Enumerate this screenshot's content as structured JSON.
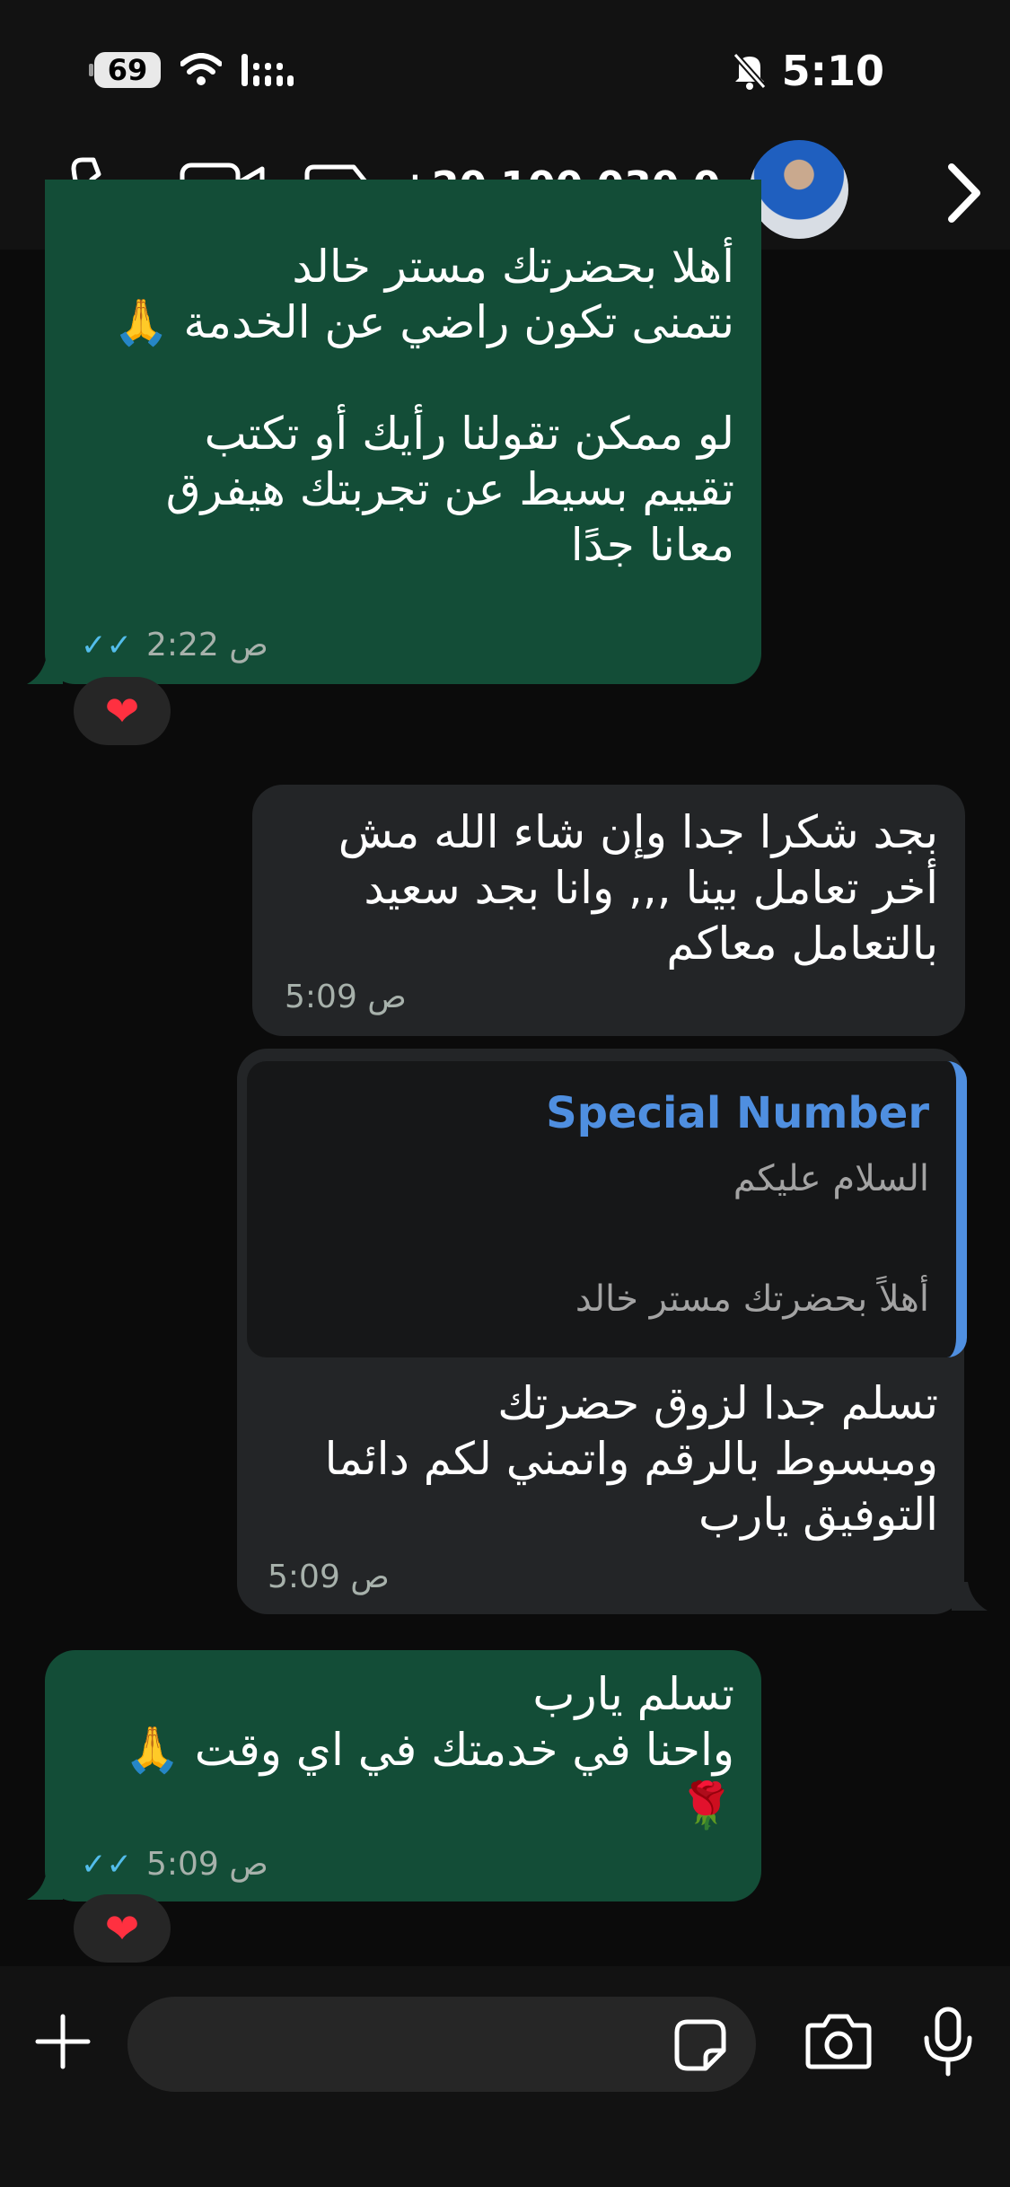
{
  "status_bar": {
    "battery": "69",
    "time": "5:10"
  },
  "header": {
    "contact_name": "+20 100 030 0..."
  },
  "messages": [
    {
      "side": "incoming",
      "text": "أهلا بحضرتك مستر خالد\nنتمنى تكون راضي عن الخدمة 🙏\n\nلو ممكن تقولنا رأيك أو تكتب\nتقييم بسيط عن تجربتك هيفرق\nمعانا جدًا",
      "time": "2:22 ص",
      "reaction": "❤"
    },
    {
      "side": "outgoing",
      "text": "بجد شكرا جدا وإن شاء الله مش\nأخر تعامل بينا ,,, وانا بجد سعيد\nبالتعامل معاكم",
      "time": "5:09 ص"
    },
    {
      "side": "outgoing",
      "quote": {
        "name": "Special Number",
        "line1": "السلام عليكم",
        "line2": "أهلاً بحضرتك مستر خالد"
      },
      "text": "تسلم جدا لزوق حضرتك\nومبسوط بالرقم واتمني لكم دائما\nالتوفيق يارب",
      "time": "5:09 ص"
    },
    {
      "side": "incoming",
      "text": "تسلم يارب\nواحنا في خدمتك في اي وقت 🙏\n🌹",
      "time": "5:09 ص",
      "reaction": "❤"
    }
  ],
  "icons": {
    "call": "phone-icon",
    "video": "video-camera-icon",
    "label": "tag-label-icon",
    "back": "chevron-right-icon",
    "add": "plus-icon",
    "sticker": "sticker-icon",
    "camera": "camera-icon",
    "mic": "microphone-icon"
  },
  "colors": {
    "incoming_bubble": "#134d37",
    "outgoing_bubble": "#232527",
    "quote_accent": "#4f8fe0",
    "read_ticks": "#53bdeb",
    "reaction_heart": "#ff3040"
  }
}
